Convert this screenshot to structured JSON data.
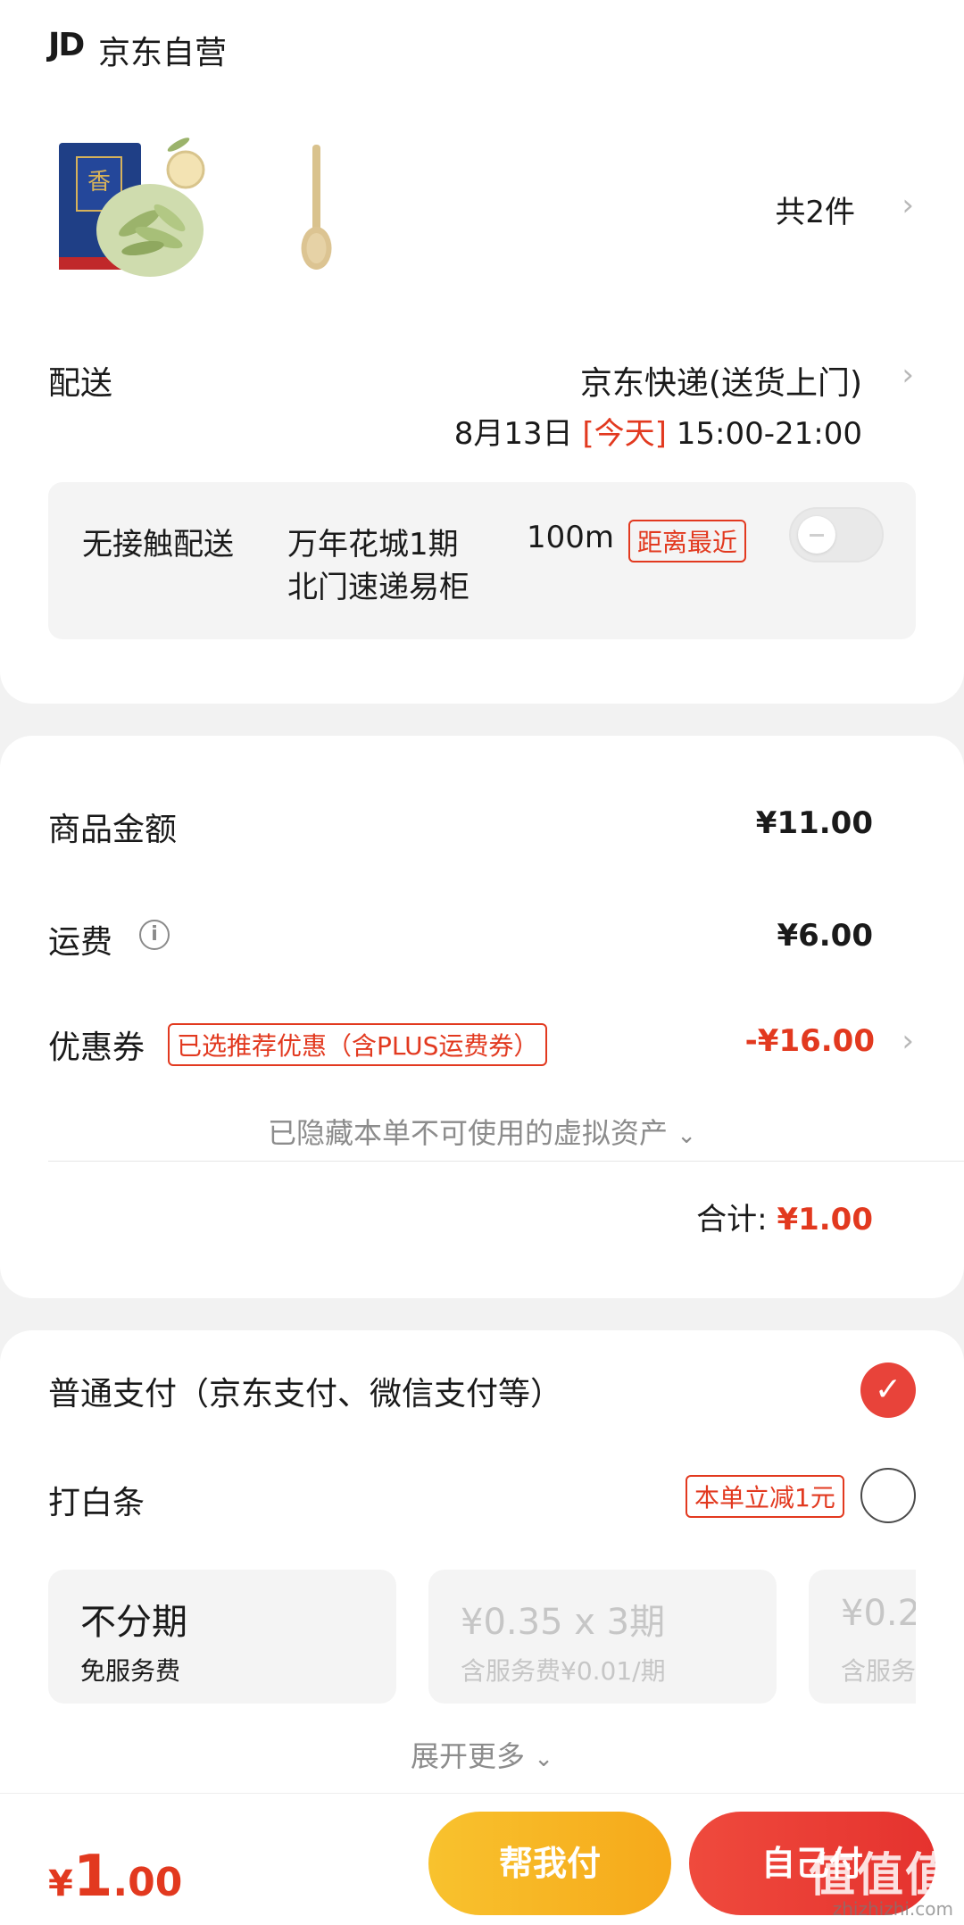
{
  "shop": {
    "logo": "JD",
    "name": "京东自营"
  },
  "products": {
    "items": [
      {
        "name": "tea-bag-image",
        "icon": "tea-package-icon"
      },
      {
        "name": "wooden-spoon-image",
        "icon": "wooden-spoon-icon"
      }
    ],
    "count_label": "共2件"
  },
  "delivery": {
    "label": "配送",
    "method": "京东快递(送货上门)",
    "date": "8月13日",
    "today_label": "[今天]",
    "time_range": "15:00-21:00"
  },
  "contactless": {
    "label": "无接触配送",
    "location_line1": "万年花城1期",
    "distance": "100m",
    "location_line2": "北门速递易柜",
    "badge": "距离最近",
    "enabled": false
  },
  "price": {
    "goods_label": "商品金额",
    "goods_value": "¥11.00",
    "shipping_label": "运费",
    "shipping_value": "¥6.00",
    "coupon_label": "优惠券",
    "coupon_tag": "已选推荐优惠（含PLUS运费券）",
    "coupon_value": "-¥16.00",
    "hidden_assets": "已隐藏本单不可使用的虚拟资产",
    "total_label": "合计:",
    "total_value": "¥1.00"
  },
  "payment": {
    "normal_label": "普通支付（京东支付、微信支付等）",
    "normal_selected": true,
    "baitiao_label": "打白条",
    "baitiao_badge": "本单立减1元",
    "baitiao_selected": false,
    "plans": [
      {
        "title": "不分期",
        "sub": "免服务费",
        "enabled": true
      },
      {
        "title": "¥0.35 x 3期",
        "sub": "含服务费¥0.01/期",
        "enabled": false
      },
      {
        "title": "¥0.2",
        "sub": "含服务费",
        "enabled": false
      }
    ],
    "expand_label": "展开更多"
  },
  "bottom": {
    "currency": "¥",
    "amount_int": "1",
    "amount_dec": ".00",
    "help_pay": "帮我付",
    "self_pay": "自己付"
  },
  "watermark": {
    "main": "值值值",
    "sub": "zhizhizhi.com"
  },
  "colors": {
    "accent_red": "#e2391f",
    "help_yellow": "#f6a91a"
  }
}
